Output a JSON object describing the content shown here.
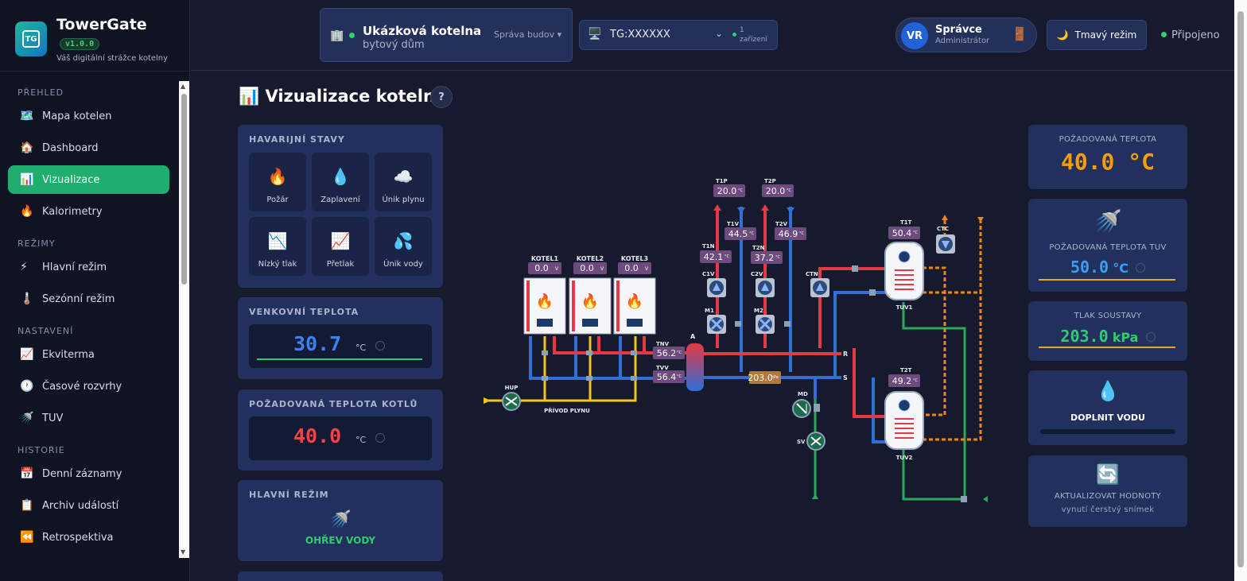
{
  "brand": {
    "name": "TowerGate",
    "version": "v1.0.0",
    "tagline": "Váš digitální strážce kotelny",
    "logo_text": "TG"
  },
  "nav": {
    "sections": [
      {
        "label": "PŘEHLED",
        "items": [
          {
            "icon": "🗺️",
            "label": "Mapa kotelen"
          },
          {
            "icon": "🏠",
            "label": "Dashboard"
          },
          {
            "icon": "📊",
            "label": "Vizualizace",
            "active": true
          },
          {
            "icon": "🔥",
            "label": "Kalorimetry"
          }
        ]
      },
      {
        "label": "REŽIMY",
        "items": [
          {
            "icon": "⚡",
            "label": "Hlavní režim"
          },
          {
            "icon": "🌡️",
            "label": "Sezónní režim"
          }
        ]
      },
      {
        "label": "NASTAVENÍ",
        "items": [
          {
            "icon": "📈",
            "label": "Ekviterma"
          },
          {
            "icon": "🕐",
            "label": "Časové rozvrhy"
          },
          {
            "icon": "🚿",
            "label": "TUV"
          }
        ]
      },
      {
        "label": "HISTORIE",
        "items": [
          {
            "icon": "📅",
            "label": "Denní záznamy"
          },
          {
            "icon": "📋",
            "label": "Archiv událostí"
          },
          {
            "icon": "⏪",
            "label": "Retrospektiva"
          }
        ]
      }
    ]
  },
  "header": {
    "building": {
      "icon": "🏢",
      "name": "Ukázková kotelna",
      "type": "bytový dům",
      "manage": "Správa budov",
      "chevron": "▾"
    },
    "device": {
      "icon": "🖥️",
      "id": "TG:XXXXXX",
      "chevron": "⌄",
      "count_line1": "1",
      "count_line2": "zařízení"
    },
    "user": {
      "initials": "VR",
      "name": "Správce",
      "role": "Administrátor",
      "logout_icon": "🚪"
    },
    "dark_mode": {
      "icon": "🌙",
      "label": "Tmavý režim"
    },
    "connection": "Připojeno"
  },
  "page": {
    "icon": "📊",
    "title": "Vizualizace kotelny",
    "help": "?"
  },
  "alarms": {
    "title": "HAVARIJNÍ STAVY",
    "items": [
      {
        "icon": "🔥",
        "label": "Požár"
      },
      {
        "icon": "💧",
        "label": "Zaplavení"
      },
      {
        "icon": "☁️",
        "label": "Únik plynu"
      },
      {
        "icon": "📉",
        "label": "Nízký tlak"
      },
      {
        "icon": "📈",
        "label": "Přetlak"
      },
      {
        "icon": "💦",
        "label": "Únik vody"
      }
    ]
  },
  "outdoor": {
    "title": "VENKOVNÍ TEPLOTA",
    "value": "30.7",
    "unit": "°C",
    "color": "#3b82f6"
  },
  "boiler_setpoint": {
    "title": "POŽADOVANÁ TEPLOTA KOTLŮ",
    "value": "40.0",
    "unit": "°C",
    "color": "#ef4444"
  },
  "main_mode": {
    "title": "HLAVNÍ REŽIM",
    "icon": "🚿",
    "value": "OHŘEV VODY",
    "color": "#2ecc71"
  },
  "right": {
    "req_temp": {
      "label": "POŽADOVANÁ TEPLOTA",
      "value": "40.0 °C",
      "color": "#f59e0b"
    },
    "tuv": {
      "icon": "🚿",
      "label": "POŽADOVANÁ TEPLOTA TUV",
      "value": "50.0",
      "unit": "°C",
      "color": "#3b9df6"
    },
    "pressure": {
      "label": "TLAK SOUSTAVY",
      "value": "203.0",
      "unit": "kPa",
      "color": "#2ecc71"
    },
    "refill": {
      "icon": "💧",
      "label": "DOPLNIT VODU",
      "fill": 0
    },
    "refresh": {
      "icon": "🔄",
      "label": "AKTUALIZOVAT HODNOTY",
      "sub": "vynutí čerstvý snímek"
    }
  },
  "scheme": {
    "boilers": [
      {
        "name": "KOTEL1",
        "value": "0.0",
        "unit": "V"
      },
      {
        "name": "KOTEL2",
        "value": "0.0",
        "unit": "V"
      },
      {
        "name": "KOTEL3",
        "value": "0.0",
        "unit": "V"
      }
    ],
    "sensors": {
      "T1P": {
        "label": "T1P",
        "value": "20.0",
        "unit": "°C"
      },
      "T2P": {
        "label": "T2P",
        "value": "20.0",
        "unit": "°C"
      },
      "T1V": {
        "label": "T1V",
        "value": "44.5",
        "unit": "°C"
      },
      "T2V": {
        "label": "T2V",
        "value": "46.9",
        "unit": "°C"
      },
      "T1N": {
        "label": "T1N",
        "value": "42.1",
        "unit": "°C"
      },
      "T2N": {
        "label": "T2N",
        "value": "37.2",
        "unit": "°C"
      },
      "TNV": {
        "label": "TNV",
        "value": "56.2",
        "unit": "°C"
      },
      "TVV": {
        "label": "TVV",
        "value": "56.4",
        "unit": "°C"
      },
      "T1T": {
        "label": "T1T",
        "value": "50.4",
        "unit": "°C"
      },
      "T2T": {
        "label": "T2T",
        "value": "49.2",
        "unit": "°C"
      },
      "P": {
        "value": "203.0",
        "unit": "kPa"
      }
    },
    "labels": {
      "HUP": "HUP",
      "gas": "PŘÍVOD PLYNU",
      "A": "A",
      "R": "R",
      "S": "S",
      "C1V": "C1V",
      "C2V": "C2V",
      "M1": "M1",
      "M2": "M2",
      "CTN": "CTN",
      "CTC": "CTC",
      "MD": "MD",
      "SV": "SV",
      "TUV1": "TUV1",
      "TUV2": "TUV2"
    }
  }
}
